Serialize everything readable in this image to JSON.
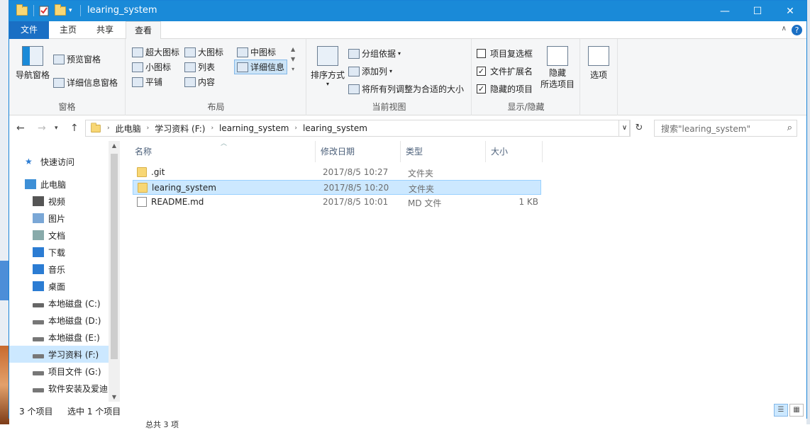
{
  "window": {
    "title": "learing_system",
    "controls": {
      "minimize": "—",
      "maximize": "☐",
      "close": "✕"
    }
  },
  "ribbon_tabs": [
    "文件",
    "主页",
    "共享",
    "查看"
  ],
  "ribbon": {
    "pane_group": {
      "label": "窗格",
      "nav_pane": "导航窗格",
      "preview_pane": "预览窗格",
      "details_pane": "详细信息窗格"
    },
    "layout_group": {
      "label": "布局",
      "items": [
        "超大图标",
        "大图标",
        "中图标",
        "小图标",
        "列表",
        "详细信息",
        "平铺",
        "内容"
      ],
      "selected": "详细信息"
    },
    "current_view_group": {
      "label": "当前视图",
      "sort_by": "排序方式",
      "group_by": "分组依据",
      "add_column": "添加列",
      "fit_columns": "将所有列调整为合适的大小"
    },
    "show_hide_group": {
      "label": "显示/隐藏",
      "item_checkboxes": {
        "label": "项目复选框",
        "checked": false
      },
      "file_extensions": {
        "label": "文件扩展名",
        "checked": true
      },
      "hidden_items": {
        "label": "隐藏的项目",
        "checked": true
      },
      "hide_selected_line1": "隐藏",
      "hide_selected_line2": "所选项目"
    },
    "options": "选项",
    "help": "?"
  },
  "address": {
    "segments": [
      "此电脑",
      "学习资料 (F:)",
      "learning_system",
      "learing_system"
    ],
    "search_placeholder": "搜索\"learing_system\""
  },
  "nav_pane": {
    "items": [
      {
        "label": "快速访问",
        "icon": "star-icon"
      },
      {
        "label": "此电脑",
        "icon": "computer-icon"
      },
      {
        "label": "视频",
        "icon": "video-icon"
      },
      {
        "label": "图片",
        "icon": "pictures-icon"
      },
      {
        "label": "文档",
        "icon": "documents-icon"
      },
      {
        "label": "下载",
        "icon": "download-icon"
      },
      {
        "label": "音乐",
        "icon": "music-icon"
      },
      {
        "label": "桌面",
        "icon": "desktop-icon"
      },
      {
        "label": "本地磁盘 (C:)",
        "icon": "system-drive-icon"
      },
      {
        "label": "本地磁盘 (D:)",
        "icon": "drive-icon"
      },
      {
        "label": "本地磁盘 (E:)",
        "icon": "drive-icon"
      },
      {
        "label": "学习资料 (F:)",
        "icon": "drive-icon",
        "selected": true
      },
      {
        "label": "项目文件 (G:)",
        "icon": "drive-icon"
      },
      {
        "label": "软件安装及爱迪",
        "icon": "drive-icon"
      }
    ]
  },
  "columns": [
    "名称",
    "修改日期",
    "类型",
    "大小"
  ],
  "files": [
    {
      "name": ".git",
      "modified": "2017/8/5 10:27",
      "type": "文件夹",
      "size": "",
      "kind": "folder"
    },
    {
      "name": "learing_system",
      "modified": "2017/8/5 10:20",
      "type": "文件夹",
      "size": "",
      "kind": "folder",
      "selected": true
    },
    {
      "name": "README.md",
      "modified": "2017/8/5 10:01",
      "type": "MD 文件",
      "size": "1 KB",
      "kind": "file"
    }
  ],
  "status": {
    "item_count": "3 个项目",
    "selected_count": "选中 1 个项目"
  },
  "behind_window_text": "总共 3 项",
  "accent_colors": {
    "titlebar": "#1a8ad8",
    "selection": "#cce8ff"
  }
}
